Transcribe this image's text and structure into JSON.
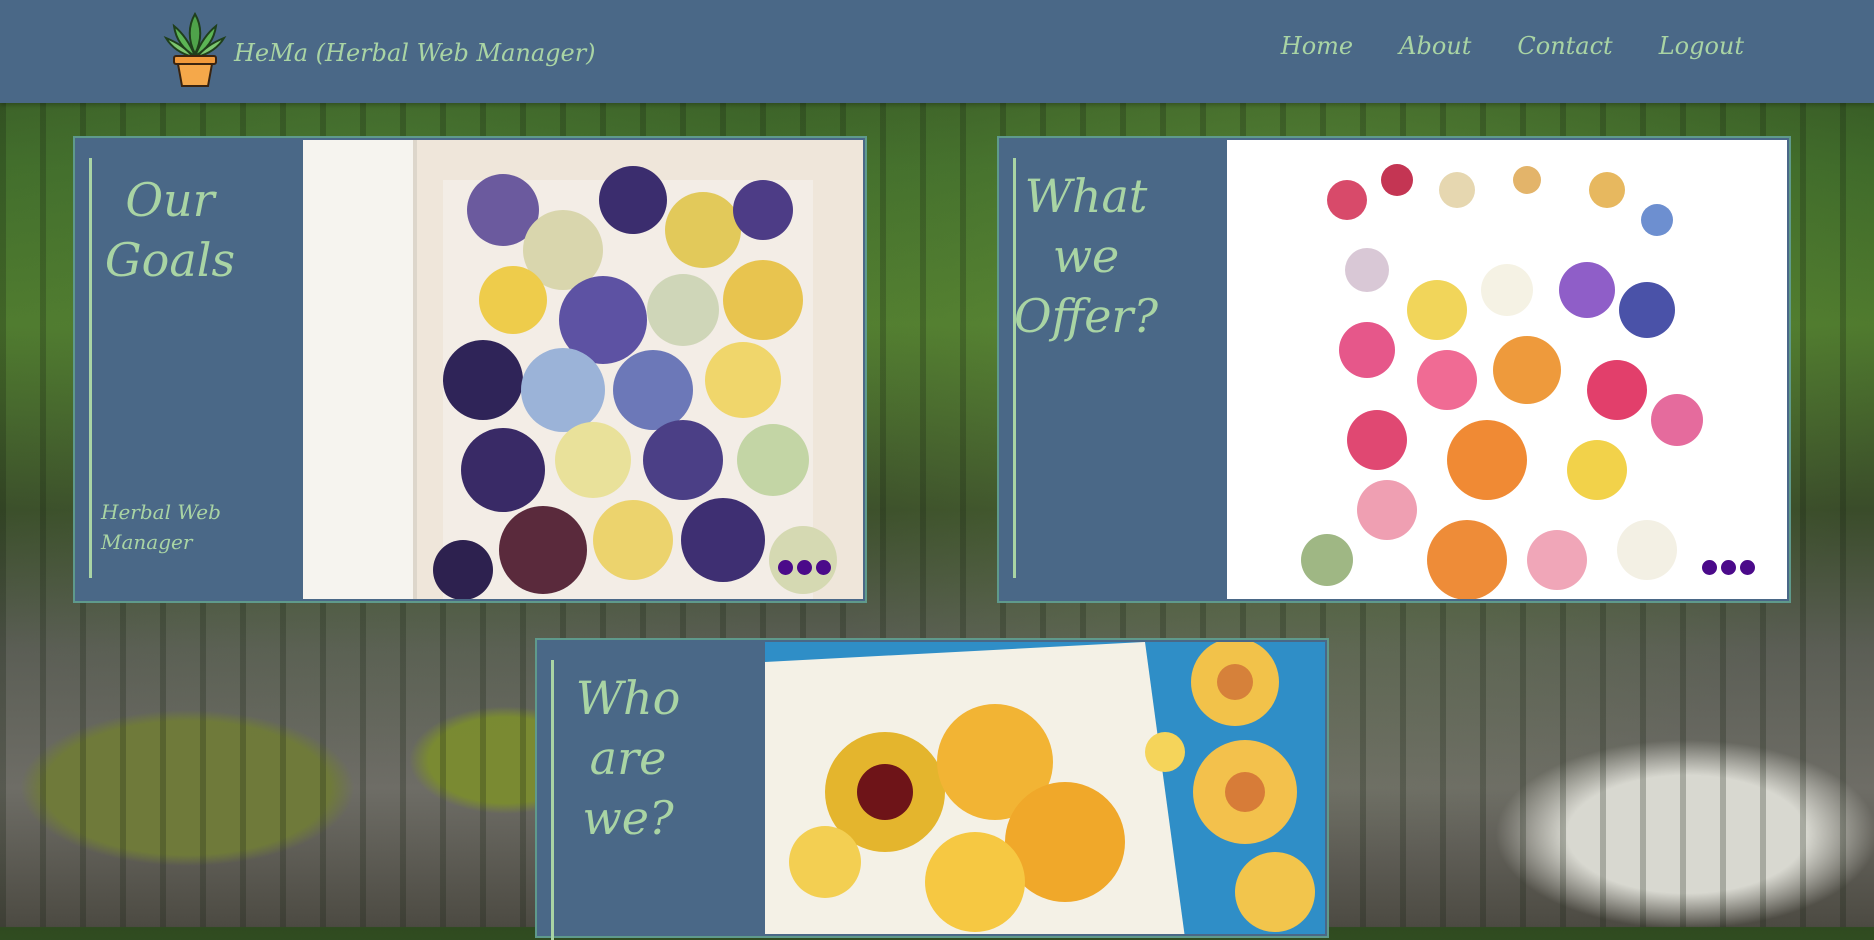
{
  "header": {
    "brand": "HeMa (Herbal Web Manager)",
    "logo_icon": "potted-plant-icon",
    "nav": [
      "Home",
      "About",
      "Contact",
      "Logout"
    ]
  },
  "cards": [
    {
      "title": "Our Goals",
      "subtitle": "Herbal Web Manager",
      "photo": "pressed-pansies-photo"
    },
    {
      "title": "What we Offer?",
      "photo": "pressed-wildflowers-photo"
    },
    {
      "title": "Who are we?",
      "photo": "pressed-yellow-flowers-photo"
    }
  ],
  "colors": {
    "header_bg": "#4a6887",
    "accent_text": "#a9d4a4",
    "card_border": "#5f9a8c",
    "dot": "#4b0a8a"
  }
}
